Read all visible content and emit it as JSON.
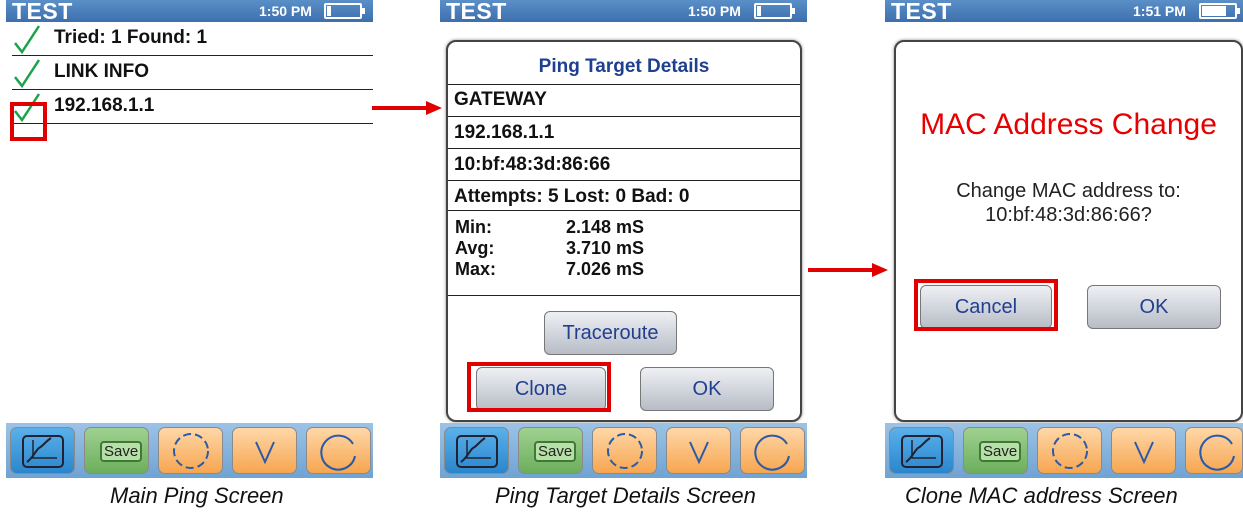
{
  "status": {
    "title": "TEST",
    "time_1": "1:50 PM",
    "time_2": "1:50 PM",
    "time_3": "1:51 PM"
  },
  "main_screen": {
    "rows": [
      {
        "label": "Tried: 1 Found: 1"
      },
      {
        "label": "LINK INFO"
      },
      {
        "label": "192.168.1.1"
      }
    ]
  },
  "details_dialog": {
    "title": "Ping Target Details",
    "name": "GATEWAY",
    "ip": "192.168.1.1",
    "mac": "10:bf:48:3d:86:66",
    "attempts": "Attempts: 5 Lost: 0 Bad: 0",
    "min_label": "Min:",
    "min_value": "2.148 mS",
    "avg_label": "Avg:",
    "avg_value": "3.710 mS",
    "max_label": "Max:",
    "max_value": "7.026 mS",
    "traceroute_label": "Traceroute",
    "clone_label": "Clone",
    "ok_label": "OK"
  },
  "mac_dialog": {
    "title": "MAC Address Change",
    "message_line1": "Change MAC address to:",
    "message_line2": "10:bf:48:3d:86:66?",
    "cancel_label": "Cancel",
    "ok_label": "OK"
  },
  "toolbar": {
    "save_label": "Save",
    "icons": [
      "graph-icon",
      "save-icon",
      "gear-icon",
      "chevron-down-icon",
      "refresh-icon"
    ]
  },
  "captions": {
    "screen1": "Main Ping Screen",
    "screen2": "Ping Target Details Screen",
    "screen3": "Clone MAC address Screen"
  },
  "colors": {
    "accent_red": "#e00000",
    "status_blue": "#3d6fae",
    "check_green": "#1aa34a",
    "dialog_title_blue": "#1f3f8f"
  }
}
